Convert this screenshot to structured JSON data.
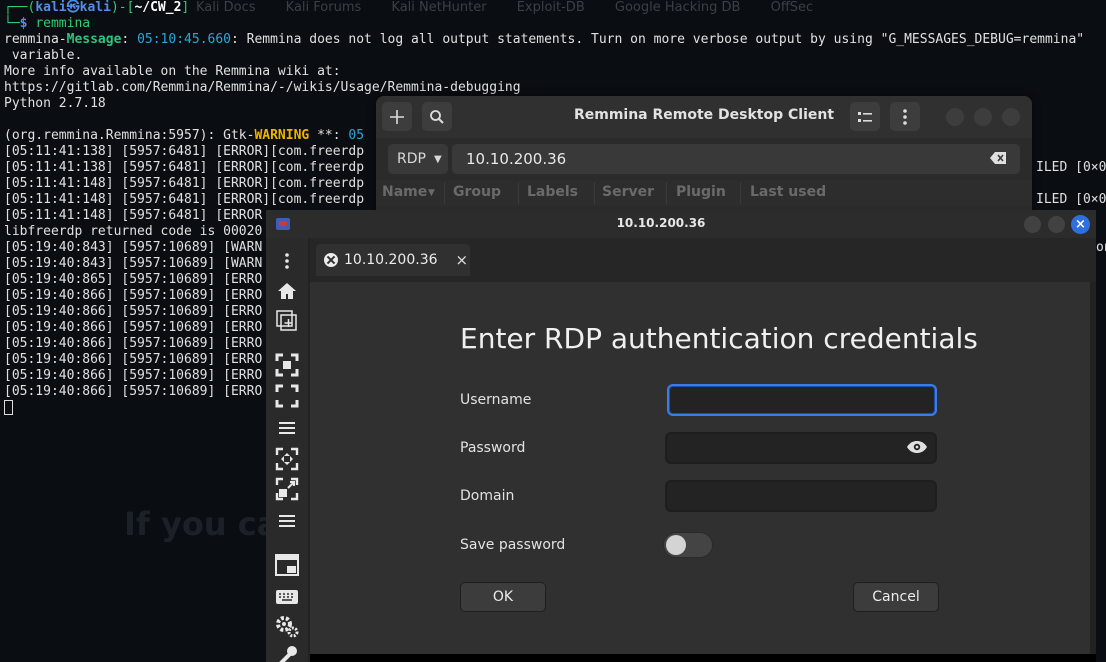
{
  "terminal": {
    "prompt_user": "kali",
    "prompt_at": "㉿",
    "prompt_host": "kali",
    "prompt_path": "~/CW_2",
    "command": "remmina",
    "msg_app": "remmina-",
    "msg_label": "Message",
    "msg_time": "05:10:45.660",
    "msg_text": ": Remmina does not log all output statements. Turn on more verbose output by using \"G_MESSAGES_DEBUG=remmina\"",
    "msg_cont": " variable.",
    "wiki_line": "More info available on the Remmina wiki at:",
    "wiki_url": "https://gitlab.com/Remmina/Remmina/-/wikis/Usage/Remmina-debugging",
    "python_line": "Python 2.7.18",
    "gtk_prefix": "(org.remmina.Remmina:5957): Gtk-",
    "gtk_warn": "WARNING",
    "gtk_suffix": " **: ",
    "gtk_time": "05",
    "log_lines": [
      "[05:11:41:138] [5957:6481] [ERROR][com.freerdp",
      "[05:11:41:138] [5957:6481] [ERROR][com.freerdp",
      "[05:11:41:148] [5957:6481] [ERROR][com.freerdp",
      "[05:11:41:148] [5957:6481] [ERROR][com.freerdp",
      "[05:11:41:148] [5957:6481] [ERROR",
      "libfreerdp returned code is 00020",
      "[05:19:40:843] [5957:10689] [WARN",
      "[05:19:40:843] [5957:10689] [WARN",
      "[05:19:40:865] [5957:10689] [ERRO",
      "[05:19:40:866] [5957:10689] [ERRO",
      "[05:19:40:866] [5957:10689] [ERRO",
      "[05:19:40:866] [5957:10689] [ERRO",
      "[05:19:40:866] [5957:10689] [ERRO",
      "[05:19:40:866] [5957:10689] [ERRO",
      "[05:19:40:866] [5957:10689] [ERRO",
      "[05:19:40:866] [5957:10689] [ERRO"
    ],
    "right_fragments": [
      "ILED [0×00",
      "ILED [0×00",
      "on"
    ],
    "faded_tabs": [
      "Kali Docs",
      "Kali Forums",
      "Kali NetHunter",
      "Exploit-DB",
      "Google Hacking DB",
      "OffSec"
    ],
    "faded_bigtext": "If you ca"
  },
  "main_window": {
    "title": "Remmina Remote Desktop Client",
    "protocol": "RDP",
    "address": "10.10.200.36",
    "columns": [
      "Name",
      "Group",
      "Labels",
      "Server",
      "Plugin",
      "Last used"
    ]
  },
  "rdp_window": {
    "title": "10.10.200.36",
    "tab_label": "10.10.200.36",
    "tab_close": "×",
    "close_glyph": "×",
    "auth_title": "Enter RDP authentication credentials",
    "username_label": "Username",
    "username_value": "",
    "password_label": "Password",
    "password_value": "",
    "domain_label": "Domain",
    "domain_value": "",
    "save_password_label": "Save password",
    "save_password_on": false,
    "ok_label": "OK",
    "cancel_label": "Cancel"
  },
  "colors": {
    "accent": "#3a7de8",
    "close_button": "#2f6fe0",
    "terminal_bg": "#0a0d12"
  }
}
